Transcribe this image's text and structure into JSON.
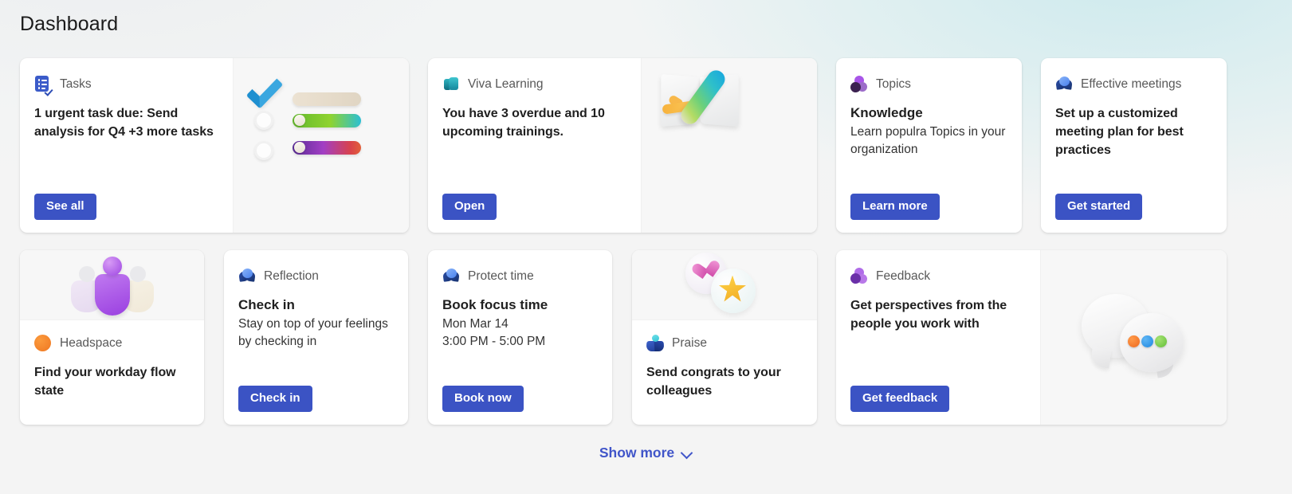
{
  "page": {
    "title": "Dashboard",
    "accent_color": "#3b53c4",
    "link_color": "#4055c9",
    "background_color": "#f4f4f4"
  },
  "cards": {
    "tasks": {
      "brand": "Tasks",
      "icon": "tasks-icon",
      "headline": "1 urgent task due: Send analysis for Q4 +3 more tasks",
      "button": "See all"
    },
    "viva_learning": {
      "brand": "Viva Learning",
      "icon": "viva-learning-icon",
      "headline": "You have 3 overdue and 10 upcoming trainings.",
      "button": "Open"
    },
    "topics": {
      "brand": "Topics",
      "icon": "topics-icon",
      "title": "Knowledge",
      "body": "Learn populra Topics in your organization",
      "button": "Learn more"
    },
    "effective_meetings": {
      "brand": "Effective meetings",
      "icon": "insights-clover-icon",
      "headline": "Set up a customized meeting plan for best practices",
      "button": "Get started"
    },
    "headspace": {
      "brand": "Headspace",
      "icon": "headspace-icon",
      "headline": "Find your workday flow state"
    },
    "reflection": {
      "brand": "Reflection",
      "icon": "insights-clover-icon",
      "title": "Check in",
      "body": "Stay on top of your feelings by checking in",
      "button": "Check in"
    },
    "protect_time": {
      "brand": "Protect time",
      "icon": "insights-clover-icon",
      "title": "Book focus time",
      "date": "Mon Mar 14",
      "time_range": "3:00 PM - 5:00 PM",
      "button": "Book now"
    },
    "praise": {
      "brand": "Praise",
      "icon": "praise-icon",
      "headline": "Send congrats to your colleagues"
    },
    "feedback": {
      "brand": "Feedback",
      "icon": "feedback-icon",
      "headline": "Get perspectives from the people you work with",
      "button": "Get feedback"
    }
  },
  "footer": {
    "show_more_label": "Show more",
    "chevron_icon": "chevron-down-icon"
  }
}
